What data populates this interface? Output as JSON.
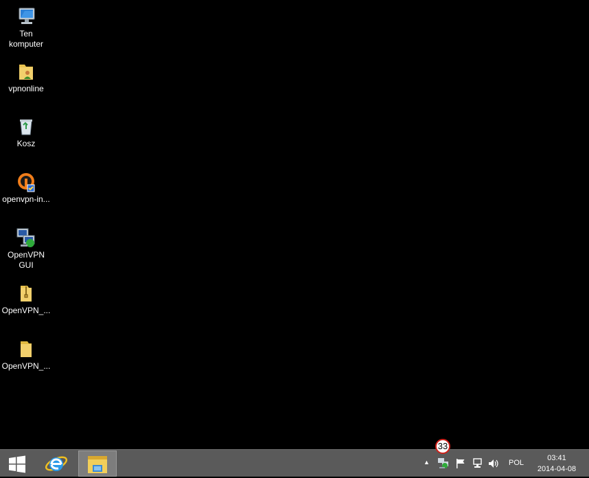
{
  "desktop": {
    "icons": [
      {
        "label": "Ten\nkomputer",
        "icon": "computer-icon"
      },
      {
        "label": "vpnonline",
        "icon": "folder-user-icon"
      },
      {
        "label": "Kosz",
        "icon": "recycle-bin-icon"
      },
      {
        "label": "openvpn-in...",
        "icon": "openvpn-installer-icon"
      },
      {
        "label": "OpenVPN GUI",
        "icon": "openvpn-gui-icon"
      },
      {
        "label": "OpenVPN_...",
        "icon": "folder-zip-icon"
      },
      {
        "label": "OpenVPN_...",
        "icon": "folder-icon"
      }
    ]
  },
  "taskbar": {
    "start_icon": "windows-logo-icon",
    "pinned": [
      {
        "name": "Internet Explorer",
        "icon": "internet-explorer-icon"
      },
      {
        "name": "File Explorer",
        "icon": "file-explorer-icon",
        "active": true
      }
    ],
    "tray": {
      "overflow_icon": "chevron-up-icon",
      "icons": [
        "openvpn-tray-icon",
        "flag-icon",
        "network-icon",
        "speaker-icon"
      ],
      "language": "POL",
      "time": "03:41",
      "date": "2014-04-08"
    },
    "badge": "33"
  },
  "colors": {
    "desktop_bg": "#000000",
    "taskbar_bg": "#5a5a5a",
    "badge_border": "#d0201a"
  }
}
